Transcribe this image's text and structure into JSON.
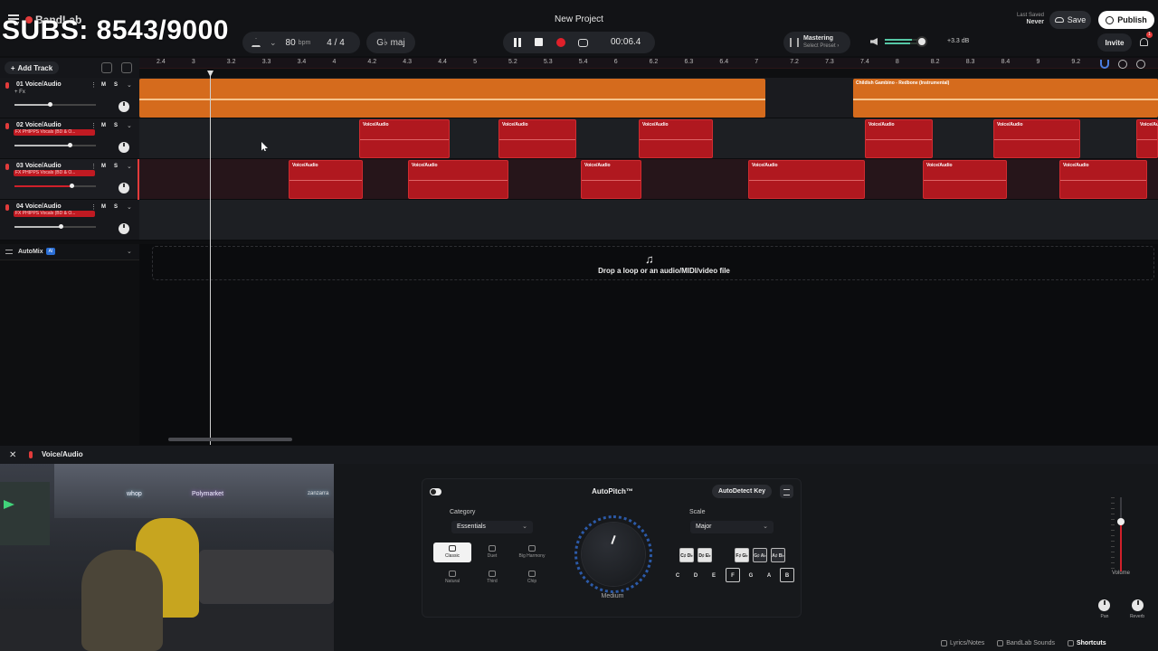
{
  "overlay": {
    "subs_counter": "SUBS: 8543/9000"
  },
  "app": {
    "brand": "BandLab",
    "project_title": "New Project"
  },
  "topbar": {
    "bpm": "80",
    "bpm_unit": "bpm",
    "time_signature": "4 / 4",
    "key": "G♭ maj",
    "time": "00:06.4",
    "mastering_label": "Mastering",
    "mastering_preset": "Select Preset ›",
    "master_db": "+3.3 dB",
    "last_saved_label": "Last Saved",
    "last_saved_value": "Never",
    "save_label": "Save",
    "publish_label": "Publish",
    "invite_label": "Invite",
    "notification_count": "1"
  },
  "track_header": {
    "add_track_label": "Add Track"
  },
  "tracks": [
    {
      "name": "01  Voice/Audio",
      "fx": "+ Fx"
    },
    {
      "name": "02  Voice/Audio",
      "preset": "FX PHIPPS Vocals (BD & O..."
    },
    {
      "name": "03  Voice/Audio",
      "preset": "FX PHIPPS Vocals (BD & O..."
    },
    {
      "name": "04  Voice/Audio",
      "preset": "FX PHIPPS Vocals (BD & O..."
    }
  ],
  "automix": {
    "label": "AutoMix",
    "badge": "AI"
  },
  "ruler_ticks": [
    "2.4",
    "3",
    "3.2",
    "3.3",
    "3.4",
    "4",
    "4.2",
    "4.3",
    "4.4",
    "5",
    "5.2",
    "5.3",
    "5.4",
    "6",
    "6.2",
    "6.3",
    "6.4",
    "7",
    "7.2",
    "7.3",
    "7.4",
    "8",
    "8.2",
    "8.3",
    "8.4",
    "9",
    "9.2"
  ],
  "clips": {
    "lane1": [
      {
        "label": ""
      },
      {
        "label": "Childish Gambino - Redbone (Instrumental)"
      }
    ],
    "clip_label": "Voice/Audio"
  },
  "drop_zone": {
    "text": "Drop a loop or an audio/MIDI/video file",
    "icon": "music-note-plus-icon"
  },
  "bottom_panel": {
    "title": "Voice/Audio"
  },
  "webcam": {
    "sign1": "whop",
    "sign2": "Polymarket",
    "sign3": "zanzarra"
  },
  "autopitch": {
    "title": "AutoPitch™",
    "autodetect_label": "AutoDetect Key",
    "category_label": "Category",
    "category_value": "Essentials",
    "modes": [
      "Classic",
      "Duet",
      "Big Harmony",
      "Natural",
      "Third",
      "Chip"
    ],
    "active_mode": "Classic",
    "knob_label": "Medium",
    "scale_label": "Scale",
    "scale_value": "Major",
    "black_keys": [
      "C♯ D♭",
      "D♯ E♭",
      "F♯ G♭",
      "G♯ A♭",
      "A♯ B♭"
    ],
    "white_keys": [
      "C",
      "D",
      "E",
      "F",
      "G",
      "A",
      "B"
    ]
  },
  "channel": {
    "volume_label": "Volume",
    "pan_label": "Pan",
    "reverb_label": "Reverb"
  },
  "footer": {
    "lyrics": "Lyrics/Notes",
    "sounds": "BandLab Sounds",
    "shortcuts": "Shortcuts"
  },
  "colors": {
    "accent_red": "#e0202a",
    "clip_orange": "#d56b1d",
    "clip_red": "#b0181f",
    "meter_green": "#56c6a5",
    "knob_blue": "#2c5aa8"
  }
}
